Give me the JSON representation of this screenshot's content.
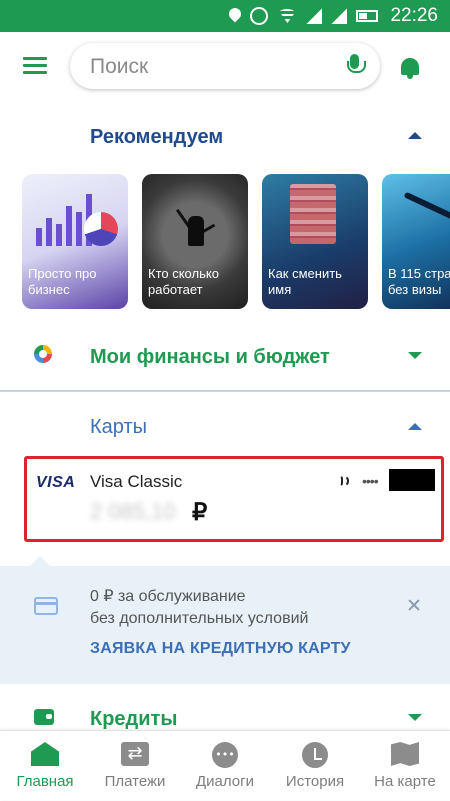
{
  "status_bar": {
    "time": "22:26",
    "icons": [
      "location-icon",
      "alarm-icon",
      "wifi-icon",
      "signal-icon",
      "battery-icon"
    ]
  },
  "header": {
    "search_placeholder": "Поиск"
  },
  "recommend": {
    "title": "Рекомендуем",
    "stories": [
      {
        "label": "Просто про\nбизнес"
      },
      {
        "label": "Кто сколько\nработает"
      },
      {
        "label": "Как сменить\nимя"
      },
      {
        "label": "В 115 стра\nбез визы"
      }
    ]
  },
  "finances": {
    "title": "Мои финансы и бюджет"
  },
  "cards": {
    "title": "Карты",
    "card": {
      "brand": "VISA",
      "name": "Visa Classic",
      "balance": "2 085,10",
      "currency": "₽",
      "mask": "••••"
    }
  },
  "promo": {
    "line1": "0 ₽ за обслуживание",
    "line2": "без дополнительных условий",
    "link": "ЗАЯВКА НА КРЕДИТНУЮ КАРТУ"
  },
  "credits": {
    "title": "Кредиты"
  },
  "nav": {
    "items": [
      {
        "label": "Главная",
        "icon": "home-icon"
      },
      {
        "label": "Платежи",
        "icon": "payments-icon"
      },
      {
        "label": "Диалоги",
        "icon": "chat-icon"
      },
      {
        "label": "История",
        "icon": "history-icon"
      },
      {
        "label": "На карте",
        "icon": "map-icon"
      }
    ]
  },
  "colors": {
    "brand_green": "#1f9a52",
    "heading_blue": "#234a8a",
    "highlight_red": "#e0232b",
    "promo_bg": "#e9f1f8"
  }
}
